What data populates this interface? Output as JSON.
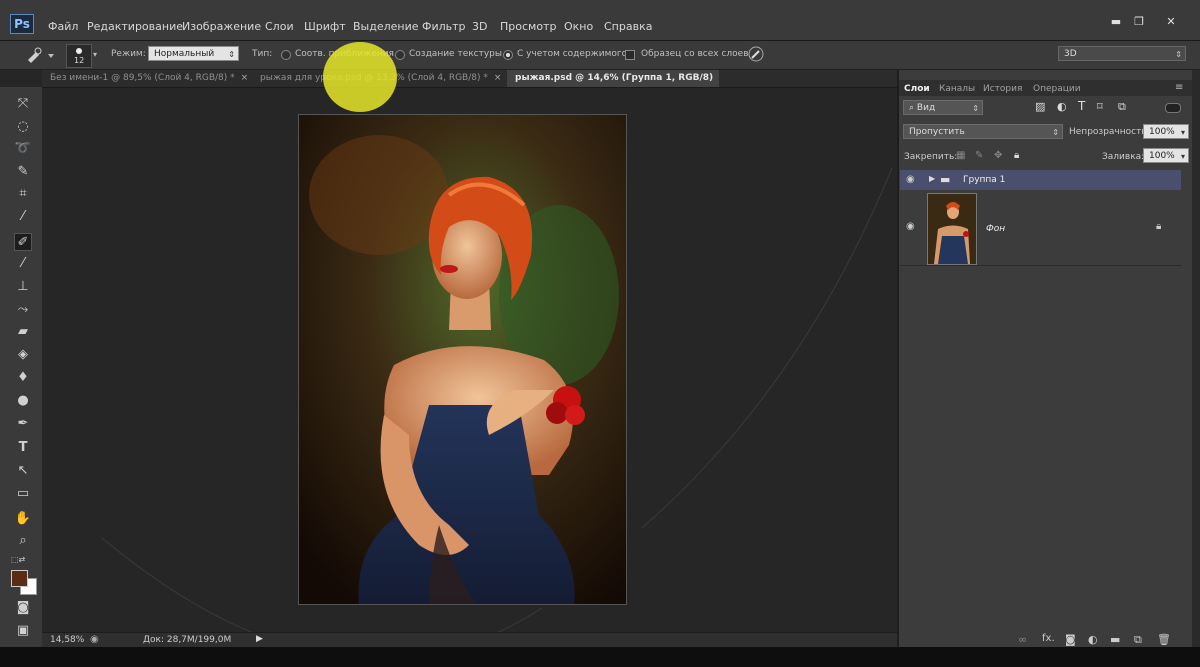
{
  "app": {
    "logo": "Ps"
  },
  "menu": [
    "Файл",
    "Редактирование",
    "Изображение",
    "Слои",
    "Шрифт",
    "Выделение",
    "Фильтр",
    "3D",
    "Просмотр",
    "Окно",
    "Справка"
  ],
  "window_controls": {
    "minimize": "▬",
    "restore": "❐",
    "close": "✕"
  },
  "options": {
    "brush_size": "12",
    "mode_label": "Режим:",
    "mode_value": "Нормальный",
    "type_label": "Тип:",
    "radio_1": "Соотв. приближения",
    "radio_2": "Создание текстуры",
    "radio_3": "С учетом содержимого",
    "checkbox_label": "Образец со всех слоев",
    "workspace": "3D"
  },
  "tabs": [
    {
      "label": "Без имени-1 @ 89,5% (Слой 4, RGB/8) *",
      "close": "×"
    },
    {
      "label": "рыжая для урока.psd @ 13,3% (Слой 4, RGB/8) *",
      "close": "×"
    },
    {
      "label": "рыжая.psd @ 14,6% (Группа 1, RGB/8) *",
      "close": "×"
    }
  ],
  "status": {
    "zoom": "14,58%",
    "doc": "Док: 28,7M/199,0M"
  },
  "panel": {
    "tabs": [
      "Слои",
      "Каналы",
      "История",
      "Операции"
    ],
    "filter_label": "Вид",
    "blend_mode": "Пропустить",
    "opacity_label": "Непрозрачность:",
    "opacity_value": "100%",
    "lock_label": "Закрепить:",
    "fill_label": "Заливка:",
    "fill_value": "100%",
    "layers": [
      {
        "name": "Группа 1",
        "type": "group"
      },
      {
        "name": "Фон",
        "type": "image"
      }
    ]
  },
  "colors": {
    "accent_selection": "#4b4f6e",
    "foreground": "#5a2b15",
    "background": "#ffffff"
  }
}
